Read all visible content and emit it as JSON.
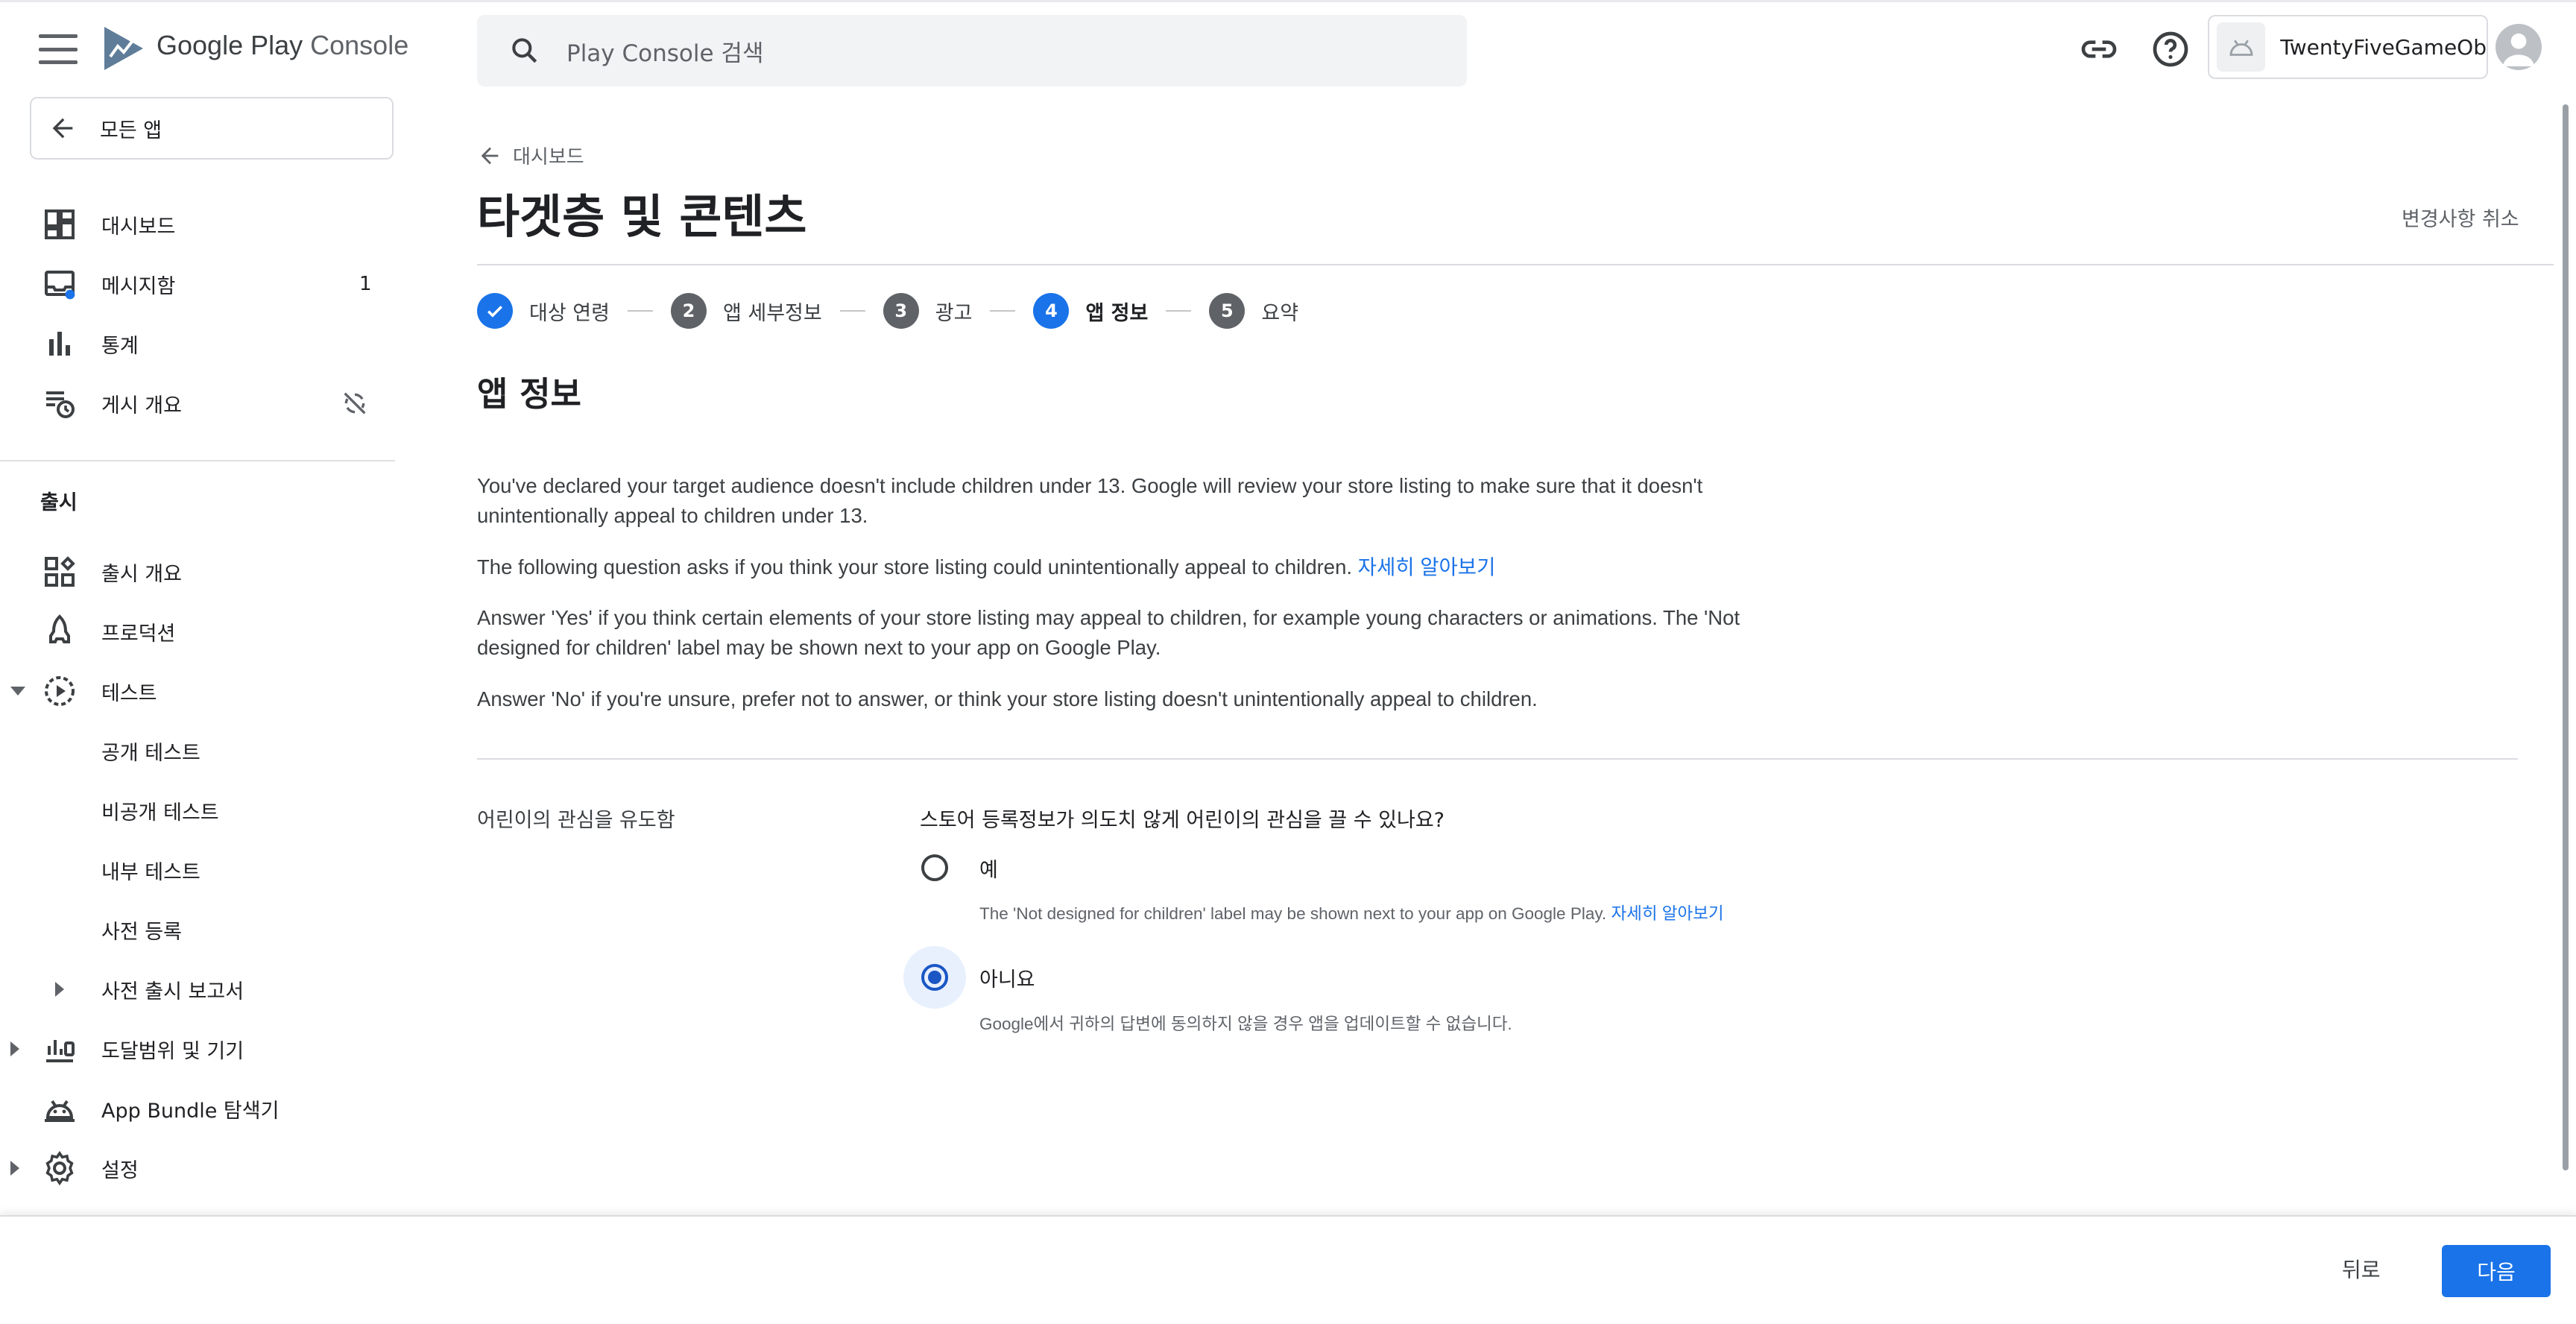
{
  "app": {
    "brand_prefix": "Google Play",
    "brand_suffix": "Console"
  },
  "sidebar": {
    "all_apps_label": "모든 앱",
    "items": [
      {
        "label": "대시보드",
        "icon": "dashboard-icon"
      },
      {
        "label": "메시지함",
        "icon": "inbox-icon",
        "count": "1"
      },
      {
        "label": "통계",
        "icon": "bar-chart-icon"
      },
      {
        "label": "게시 개요",
        "icon": "publishing-overview-icon",
        "trail_icon": "sync-disabled-icon"
      }
    ],
    "release_section_title": "출시",
    "release_items": [
      {
        "label": "출시 개요",
        "icon": "release-overview-icon"
      },
      {
        "label": "프로덕션",
        "icon": "production-icon"
      },
      {
        "label": "테스트",
        "icon": "testing-icon"
      },
      {
        "label": "공개 테스트"
      },
      {
        "label": "비공개 테스트"
      },
      {
        "label": "내부 테스트"
      },
      {
        "label": "사전 등록"
      },
      {
        "label": "사전 출시 보고서"
      },
      {
        "label": "도달범위 및 기기",
        "icon": "reach-devices-icon"
      },
      {
        "label": "App Bundle 탐색기",
        "icon": "android-icon"
      },
      {
        "label": "설정",
        "icon": "settings-icon"
      }
    ]
  },
  "topbar": {
    "search_placeholder": "Play Console 검색",
    "account_name": "TwentyFiveGameOb"
  },
  "page": {
    "back_label": "대시보드",
    "title": "타겟층 및 콘텐츠",
    "discard_label": "변경사항 취소"
  },
  "stepper": {
    "steps": [
      {
        "number": "1",
        "label": "대상 연령",
        "state": "done"
      },
      {
        "number": "2",
        "label": "앱 세부정보",
        "state": "todo"
      },
      {
        "number": "3",
        "label": "광고",
        "state": "todo"
      },
      {
        "number": "4",
        "label": "앱 정보",
        "state": "active"
      },
      {
        "number": "5",
        "label": "요약",
        "state": "todo"
      }
    ]
  },
  "content": {
    "heading": "앱 정보",
    "para1": "You've declared your target audience doesn't include children under 13. Google will review your store listing to make sure that it doesn't unintentionally appeal to children under 13.",
    "para2": "The following question asks if you think your store listing could unintentionally appeal to children.",
    "para2_link": "자세히 알아보기",
    "para3": "Answer 'Yes' if you think certain elements of your store listing may appeal to children, for example young characters or animations. The 'Not designed for children' label may be shown next to your app on Google Play.",
    "para4": "Answer 'No' if you're unsure, prefer not to answer, or think your store listing doesn't unintentionally appeal to children."
  },
  "question": {
    "field_label": "어린이의 관심을 유도함",
    "text": "스토어 등록정보가 의도치 않게 어린이의 관심을 끌 수 있나요?",
    "options": [
      {
        "label": "예",
        "help": "The 'Not designed for children' label may be shown next to your app on Google Play.",
        "help_link": "자세히 알아보기",
        "selected": false
      },
      {
        "label": "아니요",
        "help": "Google에서 귀하의 답변에 동의하지 않을 경우 앱을 업데이트할 수 없습니다.",
        "selected": true
      }
    ]
  },
  "footer": {
    "back_label": "뒤로",
    "next_label": "다음"
  },
  "colors": {
    "primary": "#1a73e8",
    "step_inactive": "#5f6368",
    "radio_selected": "#1a56c4"
  }
}
